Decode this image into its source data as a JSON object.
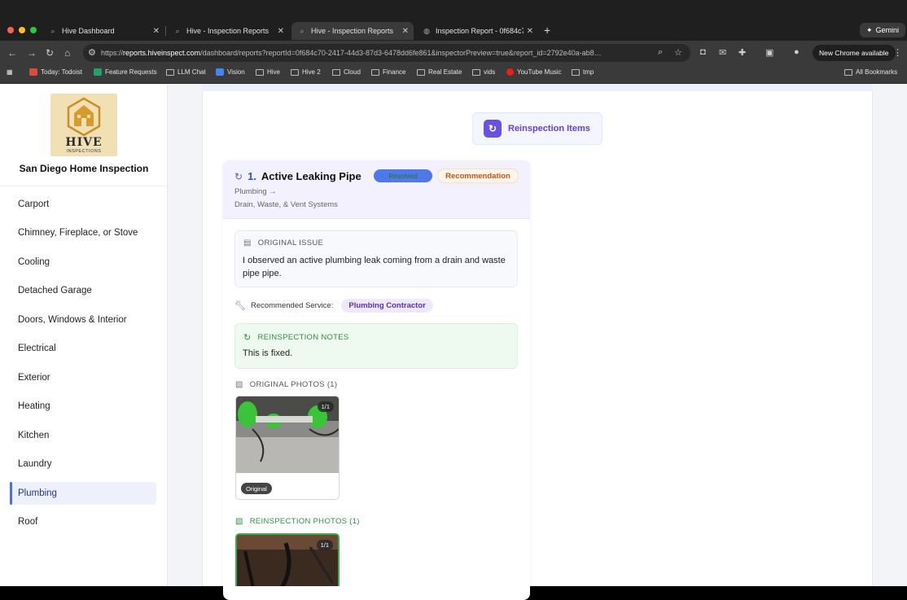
{
  "browser": {
    "tabs": [
      {
        "label": "Hive Dashboard"
      },
      {
        "label": "Hive - Inspection Reports"
      },
      {
        "label": "Hive - Inspection Reports"
      },
      {
        "label": "Inspection Report - 0f684c7("
      }
    ],
    "new_tab": "+",
    "gemini_label": "Gemini",
    "url_prefix": "https://",
    "url_host": "reports.hiveinspect.com",
    "url_rest": "/dashboard/reports?reportId=0f684c70-2417-44d3-87d3-6478dd6fe861&inspectorPreview=true&report_id=2792e40a-ab8…",
    "new_chrome": "New Chrome available",
    "bookmarks": [
      {
        "label": "Today: Todoist"
      },
      {
        "label": "Feature Requests"
      },
      {
        "label": "LLM Chat"
      },
      {
        "label": "Vision"
      },
      {
        "label": "Hive"
      },
      {
        "label": "Hive 2"
      },
      {
        "label": "Cloud"
      },
      {
        "label": "Finance"
      },
      {
        "label": "Real Estate"
      },
      {
        "label": "vids"
      },
      {
        "label": "YouTube Music"
      },
      {
        "label": "tmp"
      }
    ],
    "all_bookmarks": "All Bookmarks"
  },
  "sidebar": {
    "logo_text": "HIVE",
    "logo_sub": "INSPECTIONS",
    "company": "San Diego Home Inspection",
    "items": [
      {
        "label": "Carport"
      },
      {
        "label": "Chimney, Fireplace, or Stove"
      },
      {
        "label": "Cooling"
      },
      {
        "label": "Detached Garage"
      },
      {
        "label": "Doors, Windows & Interior"
      },
      {
        "label": "Electrical"
      },
      {
        "label": "Exterior"
      },
      {
        "label": "Heating"
      },
      {
        "label": "Kitchen"
      },
      {
        "label": "Laundry"
      },
      {
        "label": "Plumbing"
      },
      {
        "label": "Roof"
      }
    ],
    "active": "Plumbing"
  },
  "main": {
    "section_title": "Reinspection Items",
    "item": {
      "number": "1.",
      "title": "Active Leaking Pipe",
      "status_badge": "Resolved",
      "type_badge": "Recommendation",
      "path_line1": "Plumbing →",
      "path_line2": "Drain, Waste, & Vent Systems",
      "original_issue_label": "ORIGINAL ISSUE",
      "original_issue_text": "I observed an active plumbing leak coming from a drain and waste pipe pipe.",
      "recommended_service_label": "Recommended Service:",
      "recommended_service_value": "Plumbing Contractor",
      "notes_label": "REINSPECTION NOTES",
      "notes_text": "This is fixed.",
      "original_photos_label": "ORIGINAL PHOTOS (1)",
      "original_photo_count": "1/1",
      "original_photo_tag": "Original",
      "reinspection_photos_label": "REINSPECTION PHOTOS (1)",
      "reinspection_photo_count": "1/1"
    }
  },
  "colors": {
    "accent_purple": "#6a52e0",
    "resolved_blue": "#4f79e8",
    "recommendation_orange": "#c4521b",
    "notes_green": "#2f8f46"
  }
}
